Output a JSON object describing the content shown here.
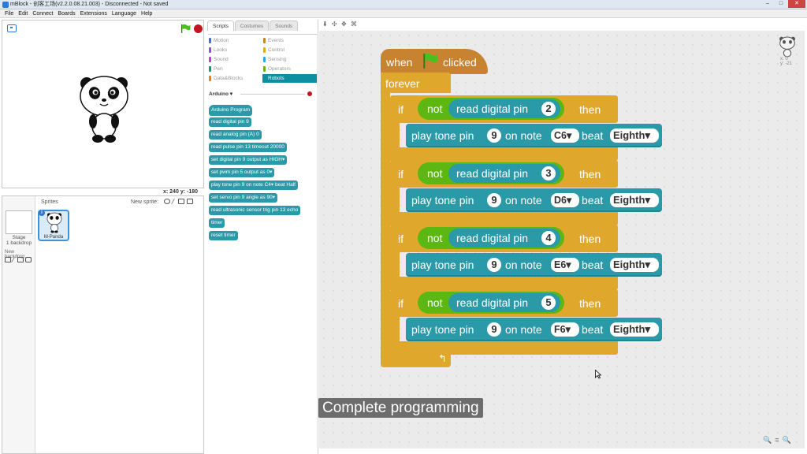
{
  "window": {
    "title": "mBlock - 创客工场(v2.2.0.08.21.003) - Disconnected - Not saved"
  },
  "menubar": [
    "File",
    "Edit",
    "Connect",
    "Boards",
    "Extensions",
    "Language",
    "Help"
  ],
  "stage": {
    "coords_x": "x: 240",
    "coords_y": "y: -180"
  },
  "sprites": {
    "header": "Sprites",
    "new_sprite": "New sprite:",
    "stage_label": "Stage",
    "stage_backdrops": "1 backdrop",
    "new_backdrop": "New backdrop:",
    "sprite_name": "M-Panda"
  },
  "palette": {
    "tabs": [
      "Scripts",
      "Costumes",
      "Sounds"
    ],
    "categories": [
      {
        "label": "Motion",
        "color": "#4a6cd4"
      },
      {
        "label": "Events",
        "color": "#c88330"
      },
      {
        "label": "Looks",
        "color": "#8a55d7"
      },
      {
        "label": "Control",
        "color": "#e1a91a"
      },
      {
        "label": "Sound",
        "color": "#bb42c3"
      },
      {
        "label": "Sensing",
        "color": "#2ca5e2"
      },
      {
        "label": "Pen",
        "color": "#0e9a6c"
      },
      {
        "label": "Operators",
        "color": "#5cb712"
      },
      {
        "label": "Data&Blocks",
        "color": "#ee7d16"
      },
      {
        "label": "Robots",
        "color": "#0e8fa1"
      }
    ],
    "extension": "Arduino",
    "blocks": [
      "Arduino Program",
      "read digital pin 9",
      "read analog pin (A) 0",
      "read pulse pin 13 timeout 20000",
      "set digital pin 9 output as HIGH▾",
      "set pwm pin 5 output as 0▾",
      "play tone pin 9 on note C4▾ beat Half",
      "set servo pin 9 angle as 90▾",
      "read ultrasonic sensor trig pin 13 echo",
      "timer",
      "reset timer"
    ]
  },
  "script": {
    "hat": {
      "when": "when",
      "clicked": "clicked"
    },
    "forever": "forever",
    "if_blocks": [
      {
        "if": "if",
        "not": "not",
        "read": "read digital pin",
        "pin": "2",
        "then": "then",
        "play": "play tone pin",
        "tone_pin": "9",
        "on_note": "on note",
        "note": "C6",
        "beat_label": "beat",
        "beat": "Eighth"
      },
      {
        "if": "if",
        "not": "not",
        "read": "read digital pin",
        "pin": "3",
        "then": "then",
        "play": "play tone pin",
        "tone_pin": "9",
        "on_note": "on note",
        "note": "D6",
        "beat_label": "beat",
        "beat": "Eighth"
      },
      {
        "if": "if",
        "not": "not",
        "read": "read digital pin",
        "pin": "4",
        "then": "then",
        "play": "play tone pin",
        "tone_pin": "9",
        "on_note": "on note",
        "note": "E6",
        "beat_label": "beat",
        "beat": "Eighth"
      },
      {
        "if": "if",
        "not": "not",
        "read": "read digital pin",
        "pin": "5",
        "then": "then",
        "play": "play tone pin",
        "tone_pin": "9",
        "on_note": "on note",
        "note": "F6",
        "beat_label": "beat",
        "beat": "Eighth"
      }
    ],
    "sprite_x": "x: 0",
    "sprite_y": "y: -21"
  },
  "caption": "Complete programming",
  "colors": {
    "events": "#c88330",
    "control": "#e0a72d",
    "operators": "#5cb712",
    "robots": "#2a9aa8"
  }
}
